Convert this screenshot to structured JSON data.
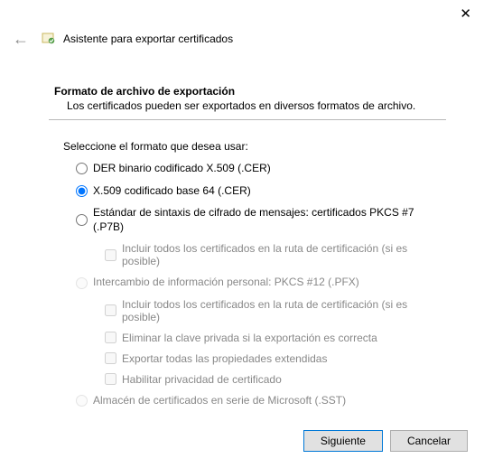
{
  "window": {
    "close_label": "✕"
  },
  "header": {
    "back_arrow": "←",
    "title": "Asistente para exportar certificados"
  },
  "section": {
    "heading": "Formato de archivo de exportación",
    "subtext": "Los certificados pueden ser exportados en diversos formatos de archivo."
  },
  "select_label": "Seleccione el formato que desea usar:",
  "options": {
    "der": "DER binario codificado X.509 (.CER)",
    "base64": "X.509 codificado base 64 (.CER)",
    "pkcs7": "Estándar de sintaxis de cifrado de mensajes: certificados PKCS #7 (.P7B)",
    "pkcs7_include": "Incluir todos los certificados en la ruta de certificación (si es posible)",
    "pfx": "Intercambio de información personal: PKCS #12 (.PFX)",
    "pfx_include": "Incluir todos los certificados en la ruta de certificación (si es posible)",
    "pfx_delete": "Eliminar la clave privada si la exportación es correcta",
    "pfx_export_ext": "Exportar todas las propiedades extendidas",
    "pfx_privacy": "Habilitar privacidad de certificado",
    "sst": "Almacén de certificados en serie de Microsoft (.SST)"
  },
  "footer": {
    "next": "Siguiente",
    "cancel": "Cancelar"
  }
}
